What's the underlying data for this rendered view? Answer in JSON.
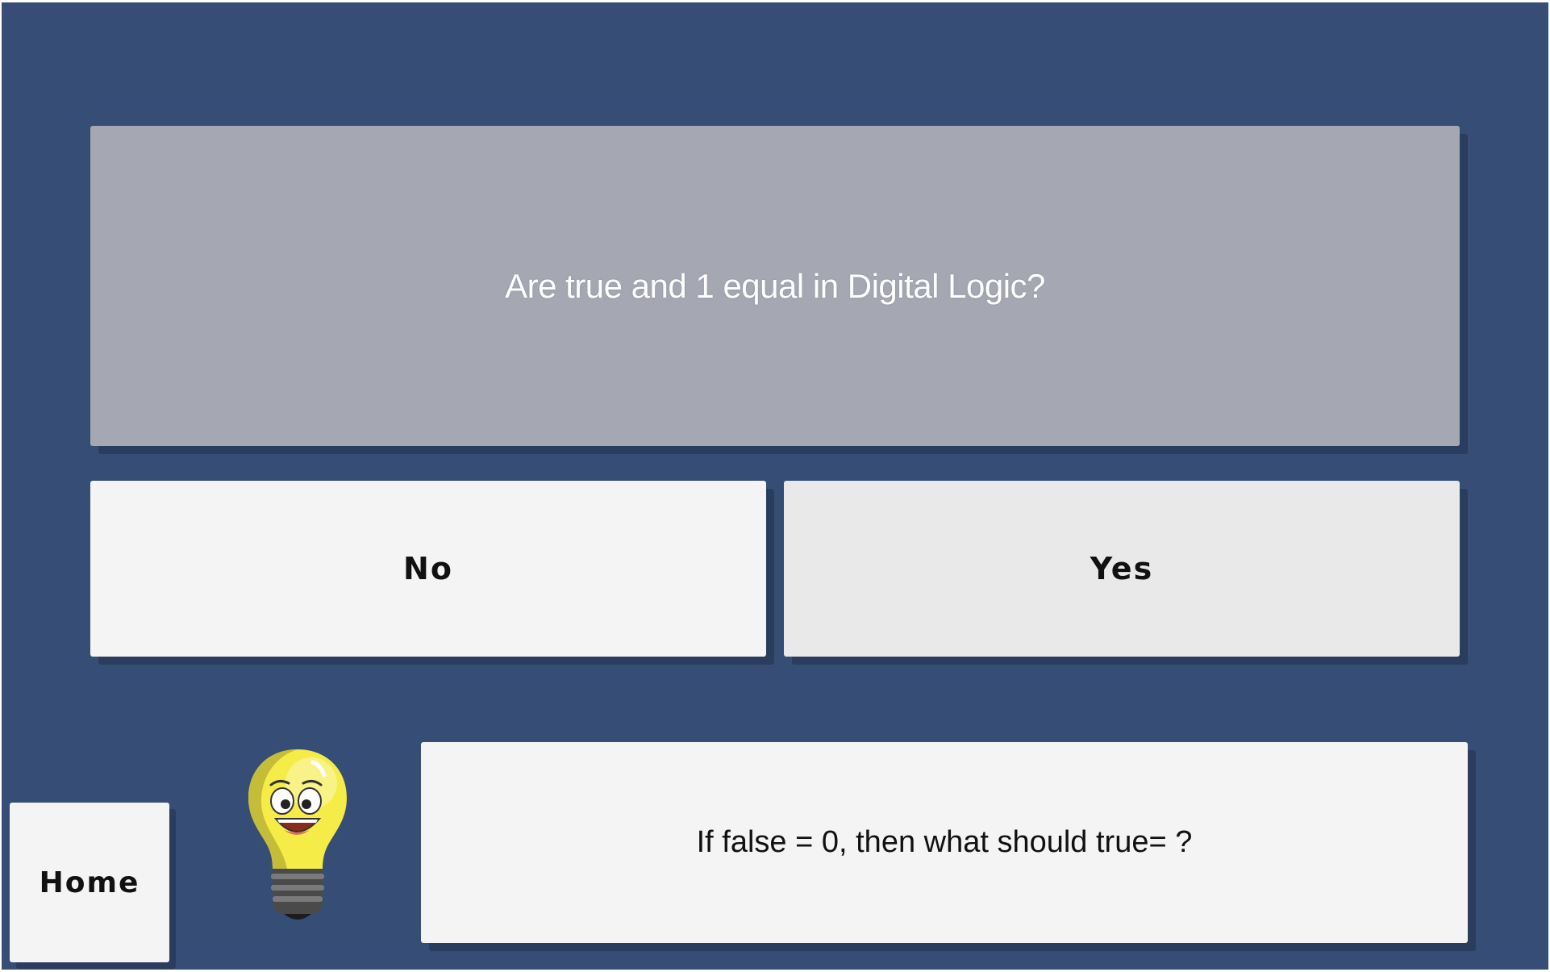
{
  "quiz": {
    "question": "Are true and 1 equal in Digital Logic?",
    "answers": [
      {
        "label": "No"
      },
      {
        "label": "Yes"
      }
    ],
    "hint": "If false = 0, then what should true= ?"
  },
  "nav": {
    "home_label": "Home"
  },
  "icons": {
    "hint_mascot": "lightbulb-mascot-icon"
  },
  "colors": {
    "background": "#364e76",
    "question_card": "#a5a7b2",
    "button": "#f4f4f4",
    "button_selected": "#e9e9e9"
  }
}
